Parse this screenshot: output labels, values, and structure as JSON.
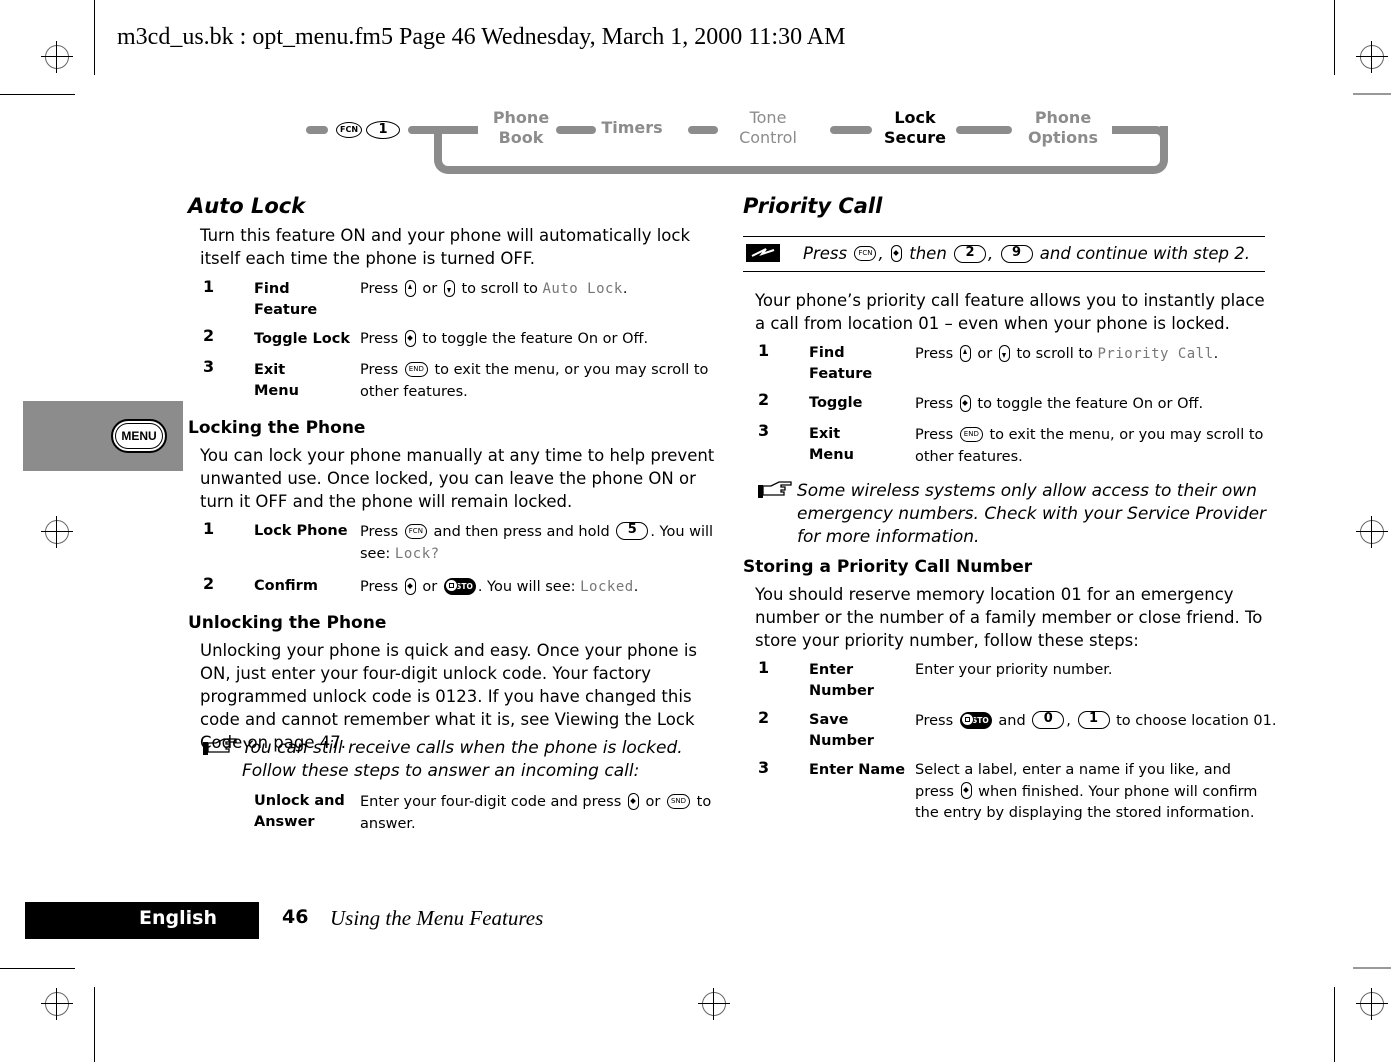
{
  "print_header": "m3cd_us.bk : opt_menu.fm5  Page 46  Wednesday, March 1, 2000  11:30 AM",
  "nav_diagram": {
    "entry_keys": [
      "FCN",
      "1"
    ],
    "items": [
      {
        "label": "Phone\nBook",
        "active": false
      },
      {
        "label": "Timers",
        "active": false
      },
      {
        "label": "Tone\nControl",
        "active": false
      },
      {
        "label": "Lock\nSecure",
        "active": true
      },
      {
        "label": "Phone\nOptions",
        "active": false
      }
    ],
    "inactive_color": "#8c8c8c",
    "active_color": "#000000"
  },
  "side_tab": {
    "label": "MENU",
    "color": "#8c8c8c"
  },
  "left_column": {
    "auto_lock": {
      "title": "Auto Lock",
      "intro": "Turn this feature ON and your phone will automatically lock itself each time the phone is turned OFF.",
      "steps": [
        {
          "num": "1",
          "label": "Find Feature",
          "desc_pre": "Press",
          "k1": "up",
          "or": "or",
          "k2": "down",
          "desc_post": "to scroll to",
          "lcd": "Auto Lock",
          "end": "."
        },
        {
          "num": "2",
          "label": "Toggle Lock",
          "desc_pre": "Press",
          "desc_post": "to toggle the feature On or Off."
        },
        {
          "num": "3",
          "label": "Exit Menu",
          "desc_pre": "Press",
          "key": "END",
          "desc_post": "to exit the menu, or you may scroll to other features."
        }
      ]
    },
    "locking": {
      "title": "Locking the Phone",
      "intro": "You can lock your phone manually at any time to help prevent unwanted use. Once locked, you can leave the phone ON or turn it OFF and the phone will remain locked.",
      "steps": [
        {
          "num": "1",
          "label": "Lock Phone",
          "desc_pre": "Press",
          "key": "FCN",
          "desc_mid": "and then press and hold",
          "num_key": "5",
          "desc_post": ". You will see:",
          "lcd": "Lock?"
        },
        {
          "num": "2",
          "label": "Confirm",
          "desc_pre": "Press",
          "or": "or",
          "key": "STO",
          "desc_post": ". You will see:",
          "lcd": "Locked",
          "end": "."
        }
      ]
    },
    "unlocking": {
      "title": "Unlocking the Phone",
      "intro": "Unlocking your phone is quick and easy. Once your phone is ON, just enter your four-digit unlock code. Your factory programmed unlock code is 0123. If you have changed this code and cannot remember what it is, see Viewing the Lock Code on page 47.",
      "note": "You can still receive calls when the phone is locked. Follow these steps to answer an incoming call:",
      "step": {
        "label": "Unlock and Answer",
        "desc_pre": "Enter your four-digit code and press",
        "or": "or",
        "key": "SND",
        "desc_post": "to answer."
      }
    }
  },
  "right_column": {
    "priority_call": {
      "title": "Priority Call",
      "shortcut": {
        "pre": "Press",
        "key": "FCN",
        "mid": ", ",
        "then": "then",
        "k1": "2",
        "k2": "9",
        "post": "and continue with step 2."
      },
      "intro": "Your phone’s priority call feature allows you to instantly place a call from location 01 – even when your phone is locked.",
      "steps": [
        {
          "num": "1",
          "label": "Find Feature",
          "desc_pre": "Press",
          "or": "or",
          "desc_post": "to scroll to",
          "lcd": "Priority Call",
          "end": "."
        },
        {
          "num": "2",
          "label": "Toggle",
          "desc_pre": "Press",
          "desc_post": "to toggle the feature On or Off."
        },
        {
          "num": "3",
          "label": "Exit Menu",
          "desc_pre": "Press",
          "key": "END",
          "desc_post": "to exit the menu, or you may scroll to other features."
        }
      ],
      "note": "Some wireless systems only allow access to their own emergency numbers. Check with your Service Provider for more information."
    },
    "storing": {
      "title": "Storing a Priority Call Number",
      "intro": "You should reserve memory location 01 for an emergency number or the number of a family member or close friend. To store your priority number, follow these steps:",
      "steps": [
        {
          "num": "1",
          "label": "Enter Number",
          "desc": "Enter your priority number."
        },
        {
          "num": "2",
          "label": "Save Number",
          "desc_pre": "Press",
          "key": "STO",
          "and": "and",
          "k1": "0",
          "k2": "1",
          "desc_post": "to choose location 01."
        },
        {
          "num": "3",
          "label": "Enter Name",
          "desc_pre": "Select a label, enter a name if you like, and press",
          "desc_post": "when finished. Your phone will confirm the entry by displaying the stored information."
        }
      ]
    }
  },
  "footer": {
    "language": "English",
    "page_number": "46",
    "section_title": "Using the Menu Features"
  }
}
